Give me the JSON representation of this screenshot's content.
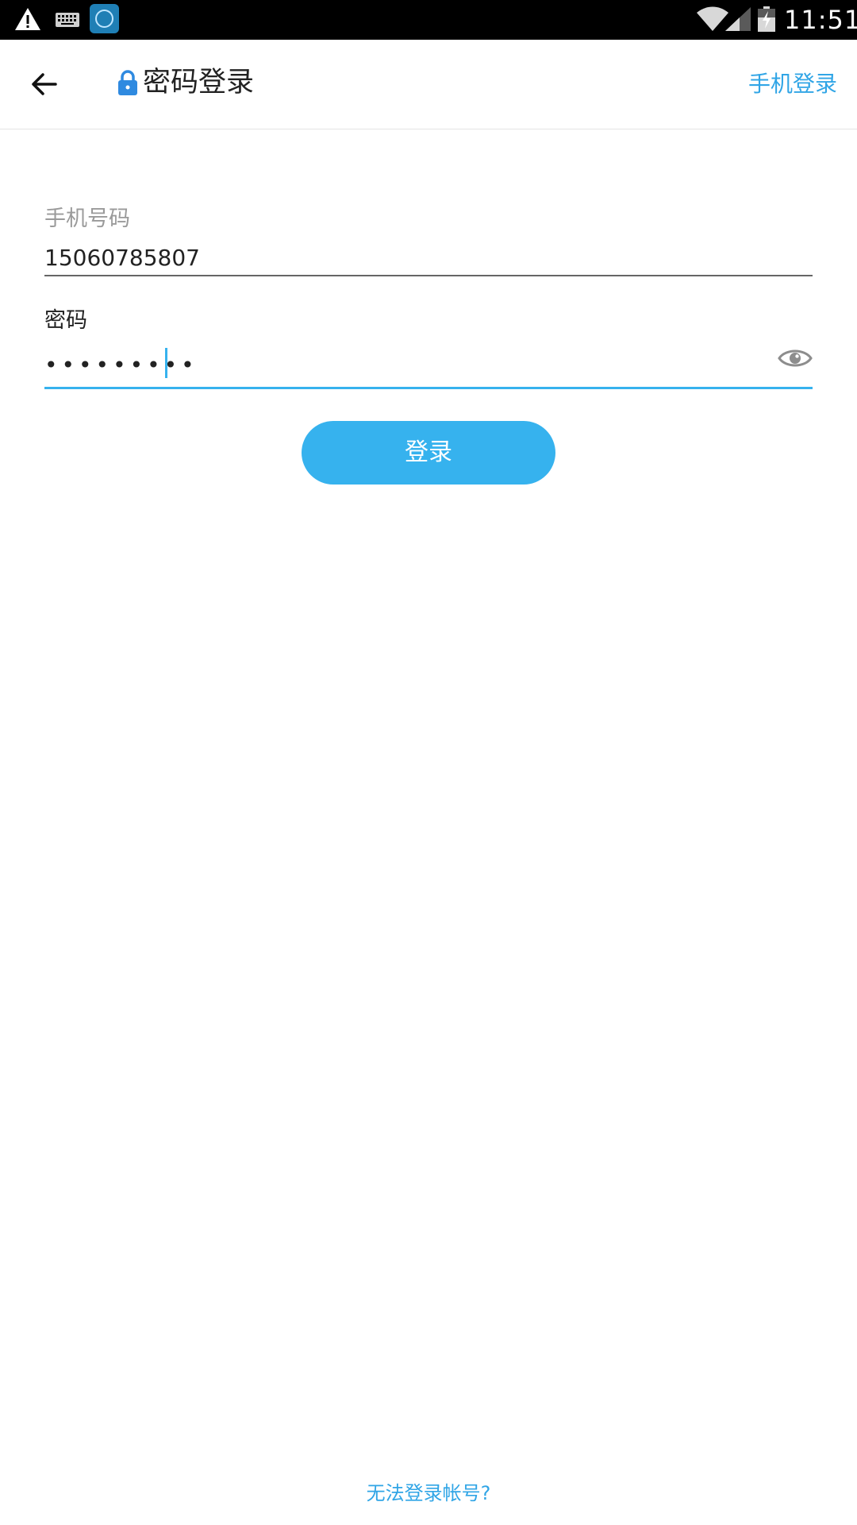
{
  "status_bar": {
    "time": "11:51",
    "icons": [
      "warning-icon",
      "keyboard-icon",
      "nox-app-icon",
      "wifi-icon",
      "signal-icon",
      "battery-charging-icon"
    ]
  },
  "header": {
    "back_icon": "back-arrow-icon",
    "title_icon": "lock-icon",
    "title": "密码登录",
    "phone_login_link": "手机登录"
  },
  "form": {
    "phone_label": "手机号码",
    "phone_value": "15060785807",
    "password_label": "密码",
    "password_value": "•••••••••",
    "password_visibility_icon": "eye-icon",
    "login_button": "登录"
  },
  "footer": {
    "cannot_login_link": "无法登录帐号?"
  },
  "colors": {
    "accent": "#36b2ee",
    "link": "#30a5e6",
    "status_bar_bg": "#000000",
    "text_primary": "#222222",
    "text_secondary": "#9a9a9a"
  }
}
